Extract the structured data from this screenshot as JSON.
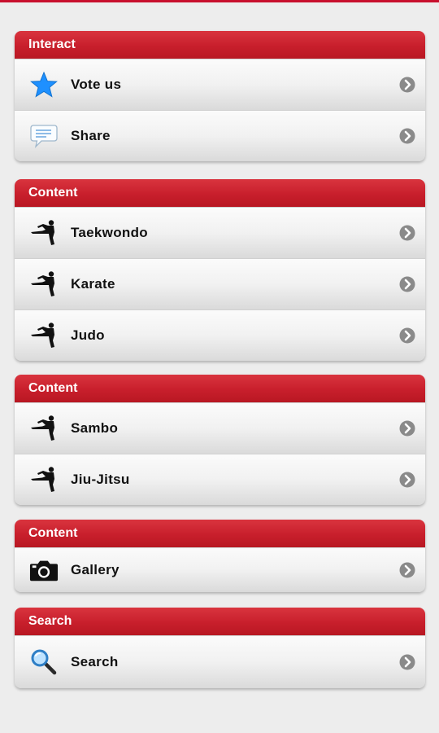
{
  "sections": [
    {
      "title": "Interact",
      "items": [
        {
          "label": "Vote us",
          "icon": "star-icon"
        },
        {
          "label": "Share",
          "icon": "speech-bubble-icon"
        }
      ]
    },
    {
      "title": "Content",
      "items": [
        {
          "label": "Taekwondo",
          "icon": "martial-artist-kick-icon"
        },
        {
          "label": "Karate",
          "icon": "martial-artist-kick-icon"
        },
        {
          "label": "Judo",
          "icon": "martial-artist-kick-icon"
        }
      ]
    },
    {
      "title": "Content",
      "items": [
        {
          "label": "Sambo",
          "icon": "martial-artist-kick-icon"
        },
        {
          "label": "Jiu-Jitsu",
          "icon": "martial-artist-kick-icon"
        }
      ]
    },
    {
      "title": "Content",
      "items": [
        {
          "label": "Gallery",
          "icon": "camera-icon"
        }
      ]
    },
    {
      "title": "Search",
      "items": [
        {
          "label": "Search",
          "icon": "magnifier-icon"
        }
      ]
    }
  ],
  "colors": {
    "header_red": "#c81f2c",
    "star_blue": "#1e90ff",
    "chevron_gray": "#8a8a8a"
  }
}
